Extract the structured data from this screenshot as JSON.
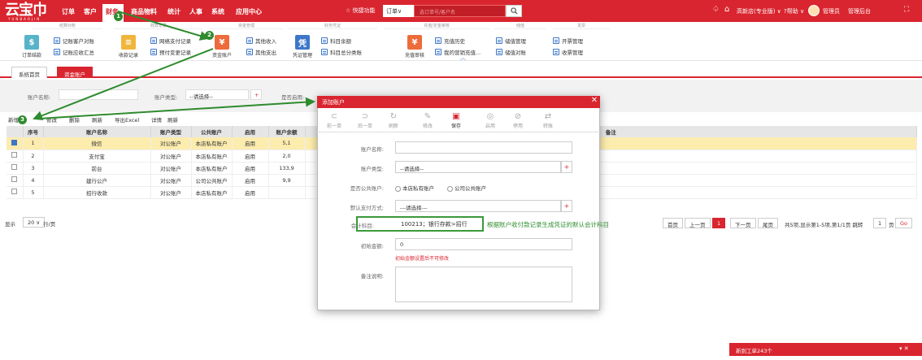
{
  "header": {
    "logo": "云宝巾",
    "logo_sub": "YUNBAOJIN",
    "nav": [
      "订单",
      "客户",
      "财务",
      "商品物料",
      "统计",
      "人事",
      "系统",
      "应用中心"
    ],
    "quick": "☆ 快捷功能",
    "search_type": "订单∨",
    "search_placeholder": "选订单号/客户名",
    "right": [
      "高新店(专业版) ∨",
      "?帮助 ∨",
      "管理员",
      "管理后台"
    ]
  },
  "submenu": {
    "groups": [
      "结算对账",
      "收款记录",
      "资金管理",
      "财务凭证",
      "充值/定金审核",
      "储值",
      "发票"
    ],
    "big": [
      "订单结款",
      "收款记录",
      "资金账户",
      "凭证管理",
      "充值审核"
    ],
    "small": [
      "记账客户对账",
      "记账应收汇总",
      "网络支付记录",
      "预付变更记录",
      "其他收入",
      "其他支出",
      "科目余额",
      "科目总分类账",
      "充值历史",
      "我的营销充值...",
      "储值管理",
      "储值对账",
      "开票管理",
      "收票管理"
    ]
  },
  "tabs": [
    "系统首页",
    "资金账户"
  ],
  "filter": {
    "name_label": "账户名称:",
    "type_label": "账户类型:",
    "type_value": "--请选择--",
    "enabled_label": "是否启用:"
  },
  "toolbar": [
    "新增",
    "修改",
    "删除",
    "刷新",
    "导出Excel",
    "详情",
    "刷新"
  ],
  "table": {
    "headers": [
      "序号",
      "账户名称",
      "账户类型",
      "公共账户",
      "启用",
      "账户余额",
      "备注"
    ],
    "rows": [
      [
        "1",
        "微信",
        "对公账户",
        "本店私有账户",
        "启用",
        "5,1"
      ],
      [
        "2",
        "支付宝",
        "对公账户",
        "本店私有账户",
        "启用",
        "2,0"
      ],
      [
        "3",
        "前台",
        "对公账户",
        "本店私有账户",
        "启用",
        "133,9"
      ],
      [
        "4",
        "建行公户",
        "对公账户",
        "公司公共账户",
        "启用",
        "9,9"
      ],
      [
        "5",
        "招行收款",
        "对公账户",
        "本店私有账户",
        "启用",
        ""
      ]
    ]
  },
  "pager": {
    "show": "显示",
    "size": "20 ∨",
    "per": "行/页",
    "first": "首页",
    "prev": "上一页",
    "cur": "1",
    "next": "下一页",
    "last": "尾页",
    "info": "共5项,显示第1-5项,第1/1页 跳转",
    "page": "1",
    "unit": "页",
    "go": "Go"
  },
  "modal": {
    "title": "添加账户",
    "toolbar": [
      "前一单",
      "后一单",
      "刷新",
      "修改",
      "保存",
      "启用",
      "停用",
      "转账"
    ],
    "labels": [
      "账户名称:",
      "账户类型:",
      "是否公共账户:",
      "默认支付方式:",
      "会计科目:",
      "初始金额:",
      "备注说明:"
    ],
    "type_value": "--请选择--",
    "radio_private": "本店私有账户",
    "radio_public": "公司公共账户",
    "pay_value": "---请选择---",
    "subject": "100213；银行存款>招行",
    "amount": "0",
    "warn": "初始金额设置后不可修改"
  },
  "annotation": {
    "tip": "根据账户收付款记录生成凭证的默认会计科目",
    "markers": [
      "1",
      "2",
      "3"
    ]
  },
  "notify": "新到工单243个",
  "colors": {
    "brand": "#d9252f",
    "annotation": "#2e8b2e"
  }
}
